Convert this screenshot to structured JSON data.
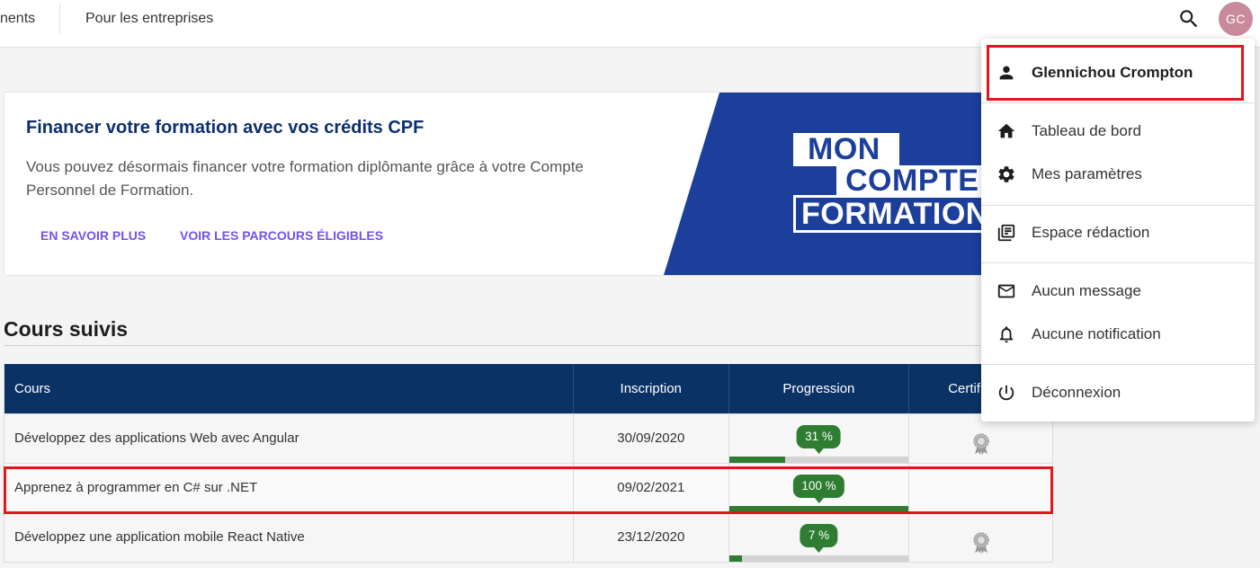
{
  "nav": {
    "items": [
      {
        "label": "nents"
      },
      {
        "label": "Pour les entreprises"
      }
    ],
    "search_icon": "search-icon",
    "avatar": {
      "initials": "GC",
      "color": "#c98a9c"
    }
  },
  "banner": {
    "title": "Financer votre formation avec vos crédits CPF",
    "body_lines": [
      "Vous pouvez désormais financer votre formation diplômante grâce à votre Compte",
      "Personnel de Formation."
    ],
    "links": [
      {
        "label": "EN SAVOIR PLUS"
      },
      {
        "label": "VOIR LES PARCOURS ÉLIGIBLES"
      }
    ],
    "logo_lines": [
      "MON",
      "COMPTE",
      "FORMATION"
    ],
    "colors": {
      "title": "#0c2f6e",
      "link": "#7451eb",
      "panel": "#1b3f9b"
    }
  },
  "courses": {
    "heading": "Cours suivis",
    "columns": [
      "Cours",
      "Inscription",
      "Progression",
      "Certif"
    ],
    "rows": [
      {
        "title": "Développez des applications Web avec Angular",
        "date": "30/09/2020",
        "progress": 31,
        "progress_label": "31 %",
        "certificate_icon": "award-icon"
      },
      {
        "title": "Apprenez à programmer en C# sur .NET",
        "date": "09/02/2021",
        "progress": 100,
        "progress_label": "100 %",
        "certificate_icon": null
      },
      {
        "title": "Développez une application mobile React Native",
        "date": "23/12/2020",
        "progress": 7,
        "progress_label": "7 %",
        "certificate_icon": "award-icon"
      }
    ],
    "colors": {
      "header": "#0b3264",
      "progress": "#2e7d32",
      "track": "#d3d3d3"
    }
  },
  "user_menu": {
    "user_name": "Glennichou Crompton",
    "user_icon": "person-icon",
    "items": [
      {
        "label": "Tableau de bord",
        "icon": "home-icon"
      },
      {
        "label": "Mes paramètres",
        "icon": "gear-icon"
      },
      {
        "label": "Espace rédaction",
        "icon": "library-books-icon"
      },
      {
        "label": "Aucun message",
        "icon": "mail-icon"
      },
      {
        "label": "Aucune notification",
        "icon": "bell-icon"
      },
      {
        "label": "Déconnexion",
        "icon": "power-icon"
      }
    ]
  },
  "highlight_color": "#e3151d"
}
